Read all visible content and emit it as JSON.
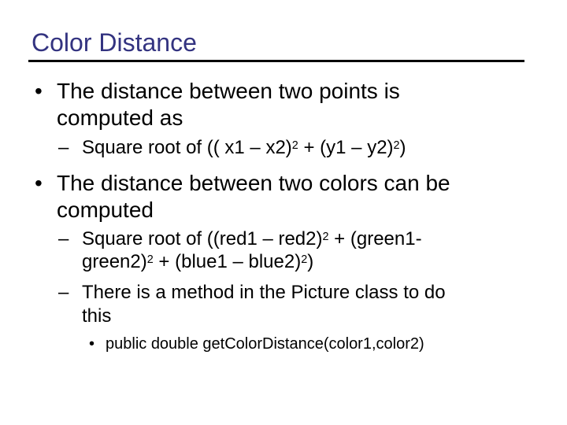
{
  "slide": {
    "title": "Color Distance",
    "title_color": "#333380",
    "bullets": [
      {
        "marker": "•",
        "lines": [
          "The distance between two points is",
          "computed as"
        ],
        "sub": [
          {
            "marker": "–",
            "line1_parts": [
              "Square root of (( x1 – x2)",
              "2",
              " + (y1 – y2)",
              "2",
              ")"
            ]
          }
        ]
      },
      {
        "marker": "•",
        "lines": [
          "The distance between two colors can be",
          "computed"
        ],
        "sub": [
          {
            "marker": "–",
            "line1": "Square root of ((red1 – red2)",
            "line1_sup": "2",
            "line1_tail": " + (green1-",
            "line2_parts": [
              "green2)",
              "2",
              " + (blue1 – blue2)",
              "2",
              ")"
            ]
          },
          {
            "marker": "–",
            "lines": [
              "There is a method in the Picture class to do",
              "this"
            ],
            "sub": [
              {
                "marker": "•",
                "text": "public double getColorDistance(color1,color2)"
              }
            ]
          }
        ]
      }
    ]
  }
}
